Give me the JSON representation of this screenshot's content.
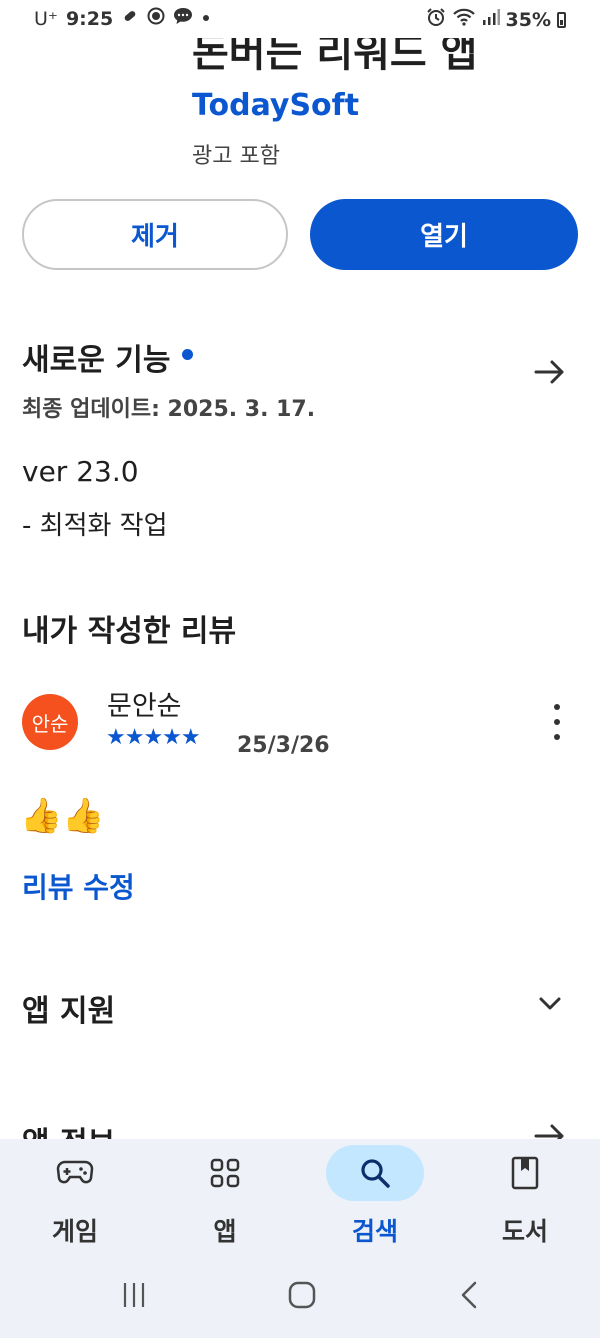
{
  "status_bar": {
    "carrier": "U⁺",
    "time": "9:25",
    "battery": "35%",
    "left_icons": [
      "link-icon",
      "messenger-icon",
      "chat-icon",
      "notification-dot-icon"
    ],
    "right_icons": [
      "alarm-icon",
      "wifi-icon",
      "signal-icon",
      "battery-icon"
    ]
  },
  "app": {
    "title": "돈버는 리워드 앱",
    "developer": "TodaySoft",
    "ad_notice": "광고 포함"
  },
  "actions": {
    "uninstall_label": "제거",
    "open_label": "열기"
  },
  "whats_new": {
    "title": "새로운 기능",
    "last_updated": "최종 업데이트: 2025. 3. 17.",
    "version": "ver 23.0",
    "note": "- 최적화 작업"
  },
  "my_review": {
    "title": "내가 작성한 리뷰",
    "avatar_text": "안순",
    "reviewer": "문안순",
    "stars": "★★★★★",
    "rating": 5,
    "date": "25/3/26",
    "text": "👍👍",
    "edit_label": "리뷰 수정"
  },
  "sections": {
    "app_support": "앱 지원",
    "app_info": "앱 정보"
  },
  "bottom_nav": {
    "items": [
      {
        "label": "게임",
        "icon": "gamepad-icon"
      },
      {
        "label": "앱",
        "icon": "apps-grid-icon"
      },
      {
        "label": "검색",
        "icon": "search-icon",
        "active": true
      },
      {
        "label": "도서",
        "icon": "book-icon"
      }
    ]
  },
  "colors": {
    "accent": "#0b57d0",
    "avatar": "#f4511e",
    "nav_bg": "#eef1f8",
    "nav_active_pill": "#c2e7ff"
  }
}
